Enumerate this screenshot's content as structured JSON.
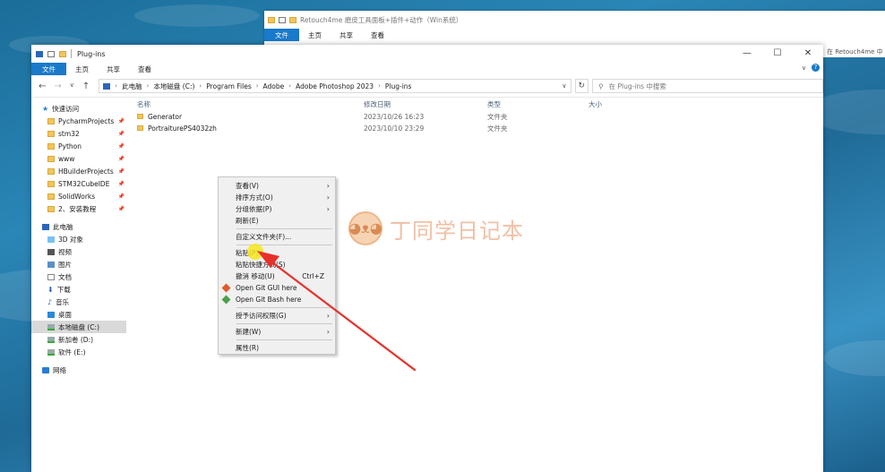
{
  "bg_window": {
    "title": "Retouch4me 磨皮工具面板+插件+动作（Win系统）",
    "tabs": [
      "文件",
      "主页",
      "共享",
      "查看"
    ],
    "search_hint": "在 Retouch4me 中"
  },
  "window": {
    "title": "Plug-ins",
    "controls": {
      "minimize": "—",
      "maximize": "☐",
      "close": "✕"
    }
  },
  "ribbon": {
    "tabs": [
      "文件",
      "主页",
      "共享",
      "查看"
    ],
    "help": "?",
    "expand": "∨"
  },
  "address": {
    "back": "←",
    "forward": "→",
    "recent": "∨",
    "up": "↑",
    "crumbs": [
      "此电脑",
      "本地磁盘 (C:)",
      "Program Files",
      "Adobe",
      "Adobe Photoshop 2023",
      "Plug-ins"
    ],
    "dropdown": "∨",
    "refresh": "↻",
    "search_placeholder": "在 Plug-ins 中搜索"
  },
  "sidebar": {
    "quick_access": "快速访问",
    "pinned": [
      "PycharmProjects",
      "stm32",
      "Python",
      "www",
      "HBuilderProjects",
      "STM32CubeIDE",
      "SolidWorks",
      "2、安装教程"
    ],
    "this_pc": "此电脑",
    "pc_items": [
      {
        "label": "3D 对象",
        "icon": "cube-icon"
      },
      {
        "label": "视频",
        "icon": "video-icon"
      },
      {
        "label": "图片",
        "icon": "picture-icon"
      },
      {
        "label": "文档",
        "icon": "document-icon"
      },
      {
        "label": "下载",
        "icon": "download-icon"
      },
      {
        "label": "音乐",
        "icon": "music-icon"
      },
      {
        "label": "桌面",
        "icon": "desktop-icon"
      }
    ],
    "drives": [
      "本地磁盘 (C:)",
      "新加卷 (D:)",
      "软件 (E:)"
    ],
    "network": "网络",
    "pin_glyph": "📌"
  },
  "columns": {
    "name": "名称",
    "date": "修改日期",
    "type": "类型",
    "size": "大小"
  },
  "files": [
    {
      "name": "Generator",
      "date": "2023/10/26 16:23",
      "type": "文件夹",
      "size": ""
    },
    {
      "name": "PortraiturePS4032zh",
      "date": "2023/10/10 23:29",
      "type": "文件夹",
      "size": ""
    }
  ],
  "context_menu": {
    "view": "查看(V)",
    "sort": "排序方式(O)",
    "group": "分组依据(P)",
    "refresh": "刷新(E)",
    "customize": "自定义文件夹(F)...",
    "paste": "粘贴(P)",
    "paste_shortcut": "粘贴快捷方式(S)",
    "undo": "撤消 移动(U)",
    "undo_shortcut": "Ctrl+Z",
    "git_gui": "Open Git GUI here",
    "git_bash": "Open Git Bash here",
    "access": "授予访问权限(G)",
    "new": "新建(W)",
    "properties": "属性(R)",
    "submenu_arrow": "›"
  },
  "watermark": {
    "text": "丁同学日记本"
  }
}
